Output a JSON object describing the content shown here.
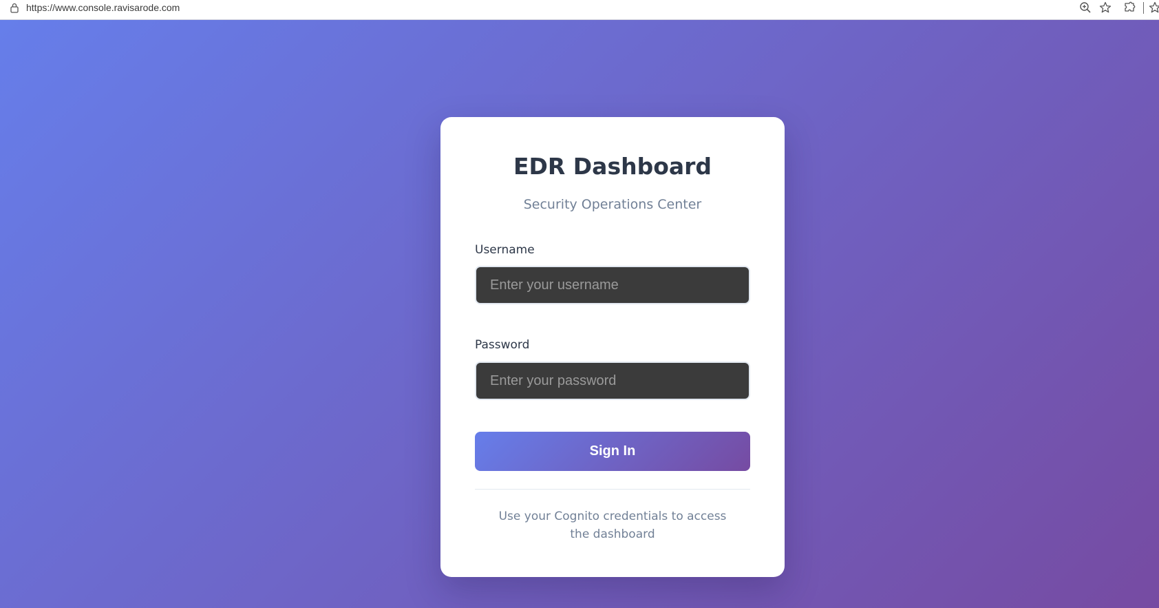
{
  "browser": {
    "url": "https://www.console.ravisarode.com",
    "icons": [
      "lock-icon",
      "zoom-icon",
      "star-icon",
      "extensions-icon",
      "favorites-icon"
    ]
  },
  "login": {
    "title": "EDR Dashboard",
    "subtitle": "Security Operations Center",
    "username_label": "Username",
    "username_placeholder": "Enter your username",
    "username_value": "",
    "password_label": "Password",
    "password_placeholder": "Enter your password",
    "password_value": "",
    "signin_label": "Sign In",
    "help_text": "Use your Cognito credentials to access the dashboard"
  },
  "colors": {
    "gradient_start": "#667eea",
    "gradient_end": "#764ba2",
    "card_bg": "#ffffff",
    "input_bg": "#3b3b3b",
    "title_text": "#2d3748",
    "muted_text": "#718096"
  }
}
